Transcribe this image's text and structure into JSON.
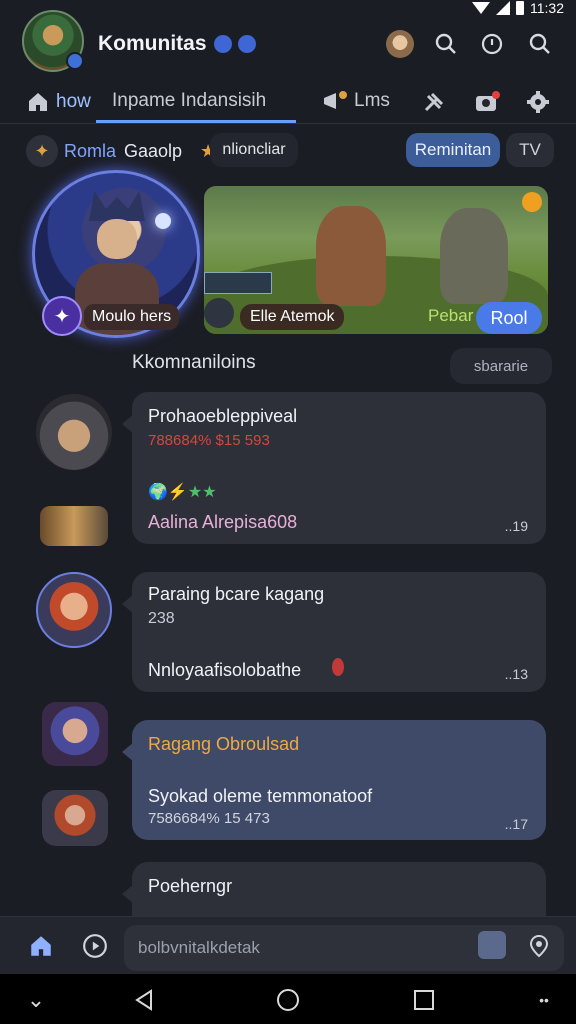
{
  "status": {
    "time": "11:32"
  },
  "header": {
    "title": "Komunitas",
    "icons": [
      "avatar-icon",
      "search-icon",
      "timer-icon",
      "search-icon"
    ]
  },
  "tabs": [
    {
      "label": "how",
      "icon": "home-icon"
    },
    {
      "label": "Inpame Indansisih"
    },
    {
      "label": "Lms",
      "icon": "megaphone-icon"
    },
    {
      "label": "",
      "icon": "tools-icon"
    },
    {
      "label": "",
      "icon": "camera-icon"
    },
    {
      "label": "",
      "icon": "gear-icon"
    }
  ],
  "chips": {
    "left_label": "Romla",
    "left_text": "Gaaolp",
    "star_text": "nlioncliar",
    "btn_primary": "Reminitan",
    "btn_secondary": "TV"
  },
  "hero": {
    "circle_label": "Moulo hers",
    "banner_label": "Elle Atemok",
    "banner_text": "Pebar",
    "banner_button": "Rool"
  },
  "section": {
    "title": "Kkomnaniloins",
    "pill": "sbararie"
  },
  "messages": [
    {
      "title": "Prohaoebleppiveal",
      "subtitle": "788684% $15 593",
      "footer": "Aalina Alrepisa608",
      "time": "..19",
      "emojis": "🌍⚡★★"
    },
    {
      "title": "Paraing bcare kagang",
      "subtitle": "238",
      "footer": "Nnloyaafisolobathe",
      "time": "..13"
    },
    {
      "title": "Ragang Obroulsad",
      "subtitle": "Syokad oleme temmonatoof",
      "footer": "7586684% 15 473",
      "time": "..17"
    },
    {
      "title": "Poeherngr"
    }
  ],
  "input": {
    "placeholder": "bolbvnitalkdetak"
  },
  "colors": {
    "accent": "#4a7ae8",
    "background": "#1b1d24",
    "bubble": "#2d3039",
    "bubble_highlight": "#3e4a68"
  }
}
